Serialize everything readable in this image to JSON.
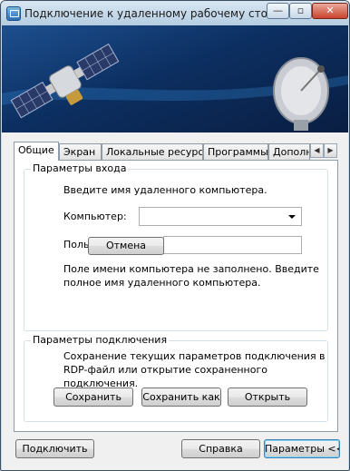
{
  "window": {
    "title": "Подключение к удаленному рабочему сто...",
    "controls": {
      "minimize": "—",
      "maximize": "▫",
      "close": "✕"
    },
    "icon": "remote-desktop-icon"
  },
  "banner": {
    "left_art": "satellite-icon",
    "right_art": "satellite-dish-icon"
  },
  "tabs": {
    "items": [
      {
        "label": "Общие",
        "active": true
      },
      {
        "label": "Экран"
      },
      {
        "label": "Локальные ресурсы"
      },
      {
        "label": "Программы"
      },
      {
        "label": "Дополн"
      }
    ],
    "scroll_left": "◀",
    "scroll_right": "▶"
  },
  "login_group": {
    "title": "Параметры входа",
    "prompt": "Введите имя удаленного компьютера.",
    "computer_label": "Компьютер:",
    "computer_value": "",
    "user_label": "Поль",
    "user_value": "",
    "cancel_button": "Отмена",
    "warning": "Поле имени компьютера не заполнено. Введите полное имя удаленного компьютера."
  },
  "connection_group": {
    "title": "Параметры подключения",
    "description": "Сохранение текущих параметров подключения в RDP-файл или открытие сохраненного подключения.",
    "save_button": "Сохранить",
    "save_as_button": "Сохранить как",
    "open_button": "Открыть"
  },
  "footer": {
    "connect_button": "Подключить",
    "help_button": "Справка",
    "options_button": "Параметры <<"
  },
  "colors": {
    "banner": "#0c2f61",
    "accent": "#3c7fb1",
    "window_frame": "#c9dbe9"
  }
}
